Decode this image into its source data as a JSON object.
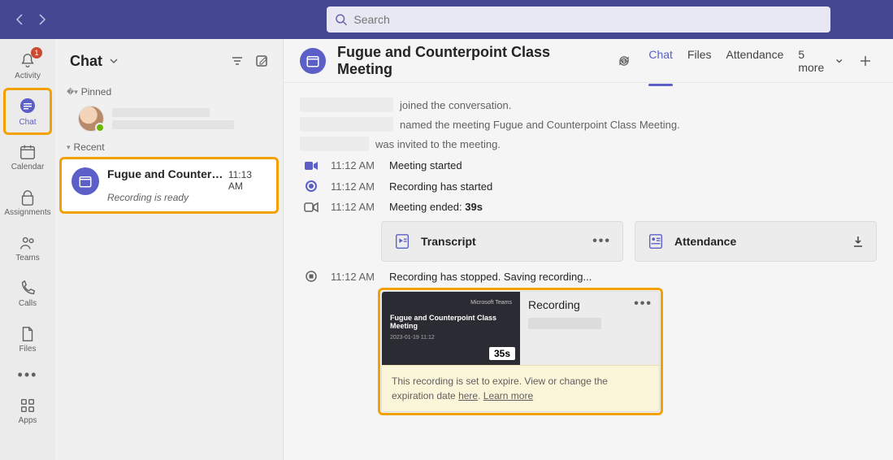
{
  "search": {
    "placeholder": "Search"
  },
  "rail": {
    "activity": {
      "label": "Activity",
      "badge": "1"
    },
    "chat": {
      "label": "Chat"
    },
    "calendar": {
      "label": "Calendar"
    },
    "assignments": {
      "label": "Assignments"
    },
    "teams": {
      "label": "Teams"
    },
    "calls": {
      "label": "Calls"
    },
    "files": {
      "label": "Files"
    },
    "apps": {
      "label": "Apps"
    }
  },
  "chatList": {
    "title": "Chat",
    "sections": {
      "pinned": "Pinned",
      "recent": "Recent"
    },
    "recentItem": {
      "title": "Fugue and Counterpo...",
      "time": "11:13 AM",
      "subtitle": "Recording is ready"
    }
  },
  "header": {
    "title": "Fugue and Counterpoint Class Meeting",
    "tabs": {
      "chat": "Chat",
      "files": "Files",
      "attendance": "Attendance",
      "more": "5 more"
    }
  },
  "feed": {
    "sys1": "joined the conversation.",
    "sys2": "named the meeting Fugue and Counterpoint Class Meeting.",
    "sys3": "was invited to the meeting.",
    "e1": {
      "time": "11:12 AM",
      "text": "Meeting started"
    },
    "e2": {
      "time": "11:12 AM",
      "text": "Recording has started"
    },
    "e3": {
      "time": "11:12 AM",
      "text_prefix": "Meeting ended: ",
      "duration": "39s"
    },
    "e4": {
      "time": "11:12 AM",
      "text": "Recording has stopped. Saving recording..."
    },
    "cards": {
      "transcript": "Transcript",
      "attendance": "Attendance"
    },
    "recording": {
      "thumb_brand": "Microsoft Teams",
      "thumb_title": "Fugue and Counterpoint Class Meeting",
      "thumb_date": "2023-01-19 11:12",
      "duration_badge": "35s",
      "side_title": "Recording",
      "warning_pre": "This recording is set to expire. View or change the expiration date ",
      "warning_here": "here",
      "warning_sep": ". ",
      "warning_learn": "Learn more"
    }
  }
}
